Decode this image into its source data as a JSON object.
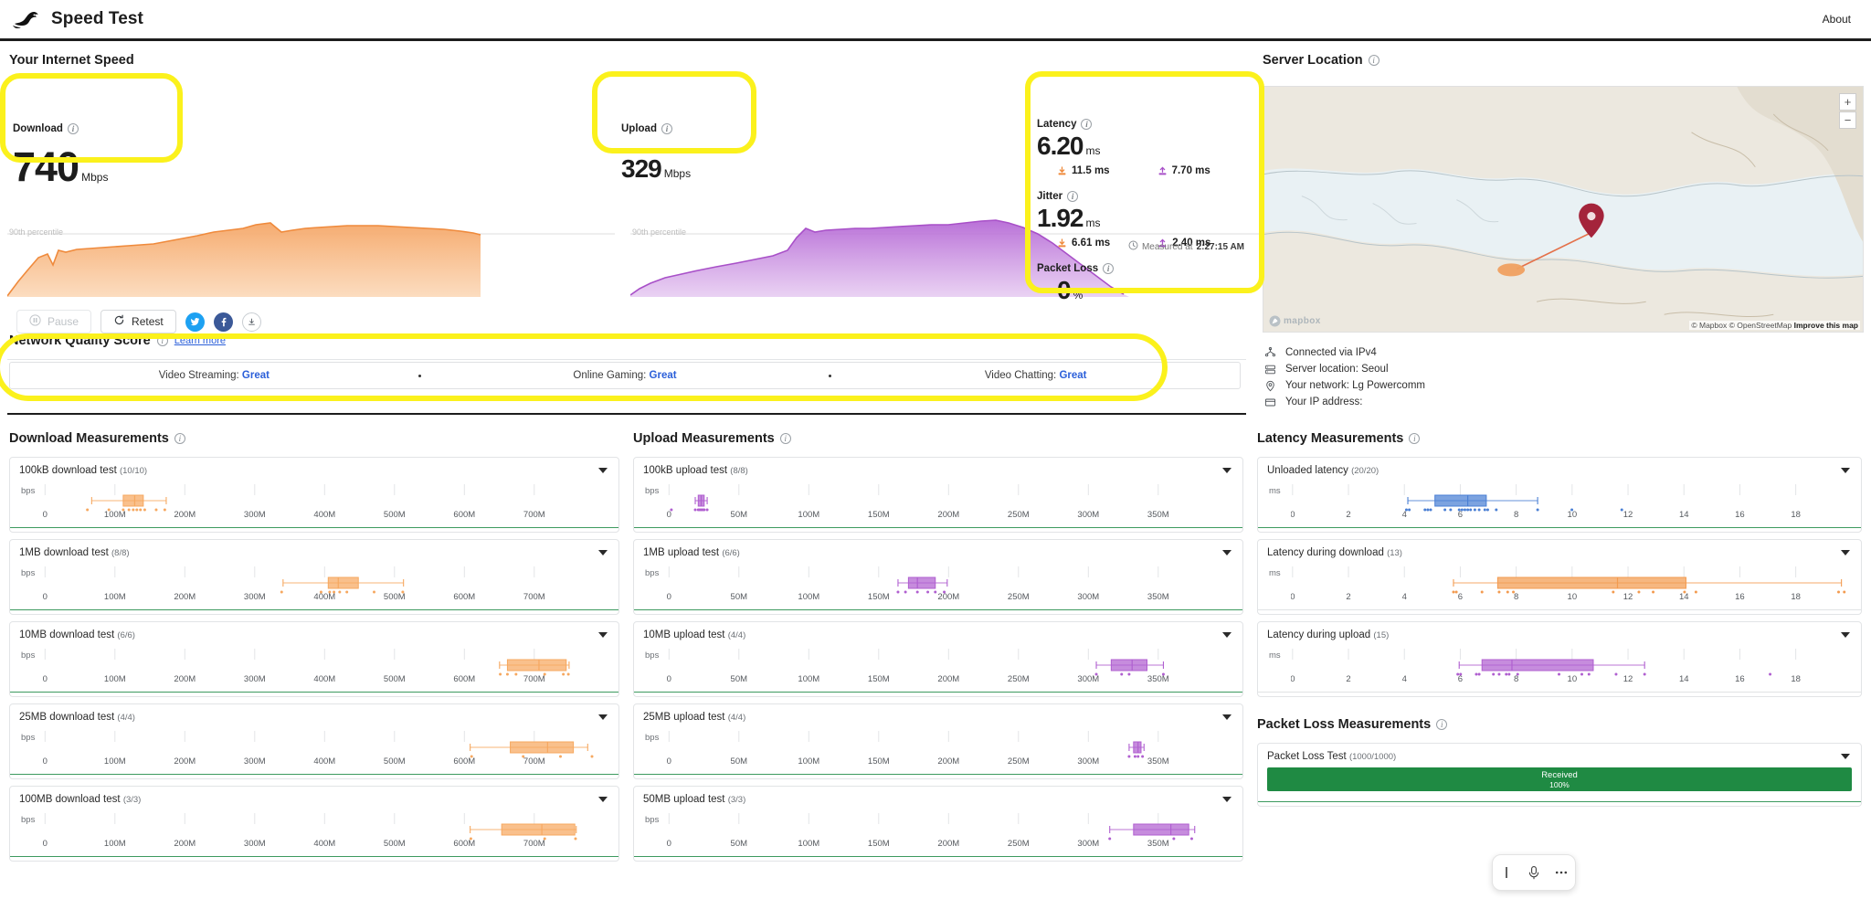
{
  "header": {
    "title": "Speed Test",
    "about_label": "About",
    "logo_icon": "rabbit-logo-icon"
  },
  "speed": {
    "section_title": "Your Internet Speed",
    "download": {
      "label": "Download",
      "value": "740",
      "unit": "Mbps",
      "percentile_label": "90th percentile"
    },
    "upload": {
      "label": "Upload",
      "value": "329",
      "unit": "Mbps",
      "percentile_label": "90th percentile"
    },
    "latency": {
      "label": "Latency",
      "value": "6.20",
      "unit": "ms",
      "download_sub": "11.5 ms",
      "upload_sub": "7.70 ms"
    },
    "jitter": {
      "label": "Jitter",
      "value": "1.92",
      "unit": "ms",
      "download_sub": "6.61 ms",
      "upload_sub": "2.40 ms"
    },
    "packet_loss": {
      "label": "Packet Loss",
      "value": "0",
      "unit": "%"
    },
    "measured_prefix": "Measured at",
    "measured_time": "2:27:15 AM"
  },
  "controls": {
    "pause_label": "Pause",
    "retest_label": "Retest",
    "twitter_icon": "twitter-icon",
    "facebook_icon": "facebook-icon",
    "download_icon": "download-icon"
  },
  "network_quality": {
    "title": "Network Quality Score",
    "learn_more": "Learn more",
    "items": [
      {
        "label": "Video Streaming:",
        "value": "Great"
      },
      {
        "label": "Online Gaming:",
        "value": "Great"
      },
      {
        "label": "Video Chatting:",
        "value": "Great"
      }
    ]
  },
  "server": {
    "title": "Server Location",
    "map_logo": "mapbox",
    "zoom_in": "+",
    "zoom_out": "−",
    "attribution": "© Mapbox © OpenStreetMap",
    "attribution_link": "Improve this map",
    "info": [
      {
        "icon": "network-icon",
        "text": "Connected via IPv4"
      },
      {
        "icon": "server-icon",
        "text": "Server location: Seoul"
      },
      {
        "icon": "location-icon",
        "text": "Your network: Lg Powercomm"
      },
      {
        "icon": "card-icon",
        "text": "Your IP address:"
      }
    ]
  },
  "measurements": {
    "download_title": "Download Measurements",
    "upload_title": "Upload Measurements",
    "latency_title": "Latency Measurements",
    "packet_loss_title": "Packet Loss Measurements",
    "download_tests": [
      {
        "name": "100kB download test",
        "count": "(10/10)"
      },
      {
        "name": "1MB download test",
        "count": "(8/8)"
      },
      {
        "name": "10MB download test",
        "count": "(6/6)"
      },
      {
        "name": "25MB download test",
        "count": "(4/4)"
      },
      {
        "name": "100MB download test",
        "count": "(3/3)"
      }
    ],
    "upload_tests": [
      {
        "name": "100kB upload test",
        "count": "(8/8)"
      },
      {
        "name": "1MB upload test",
        "count": "(6/6)"
      },
      {
        "name": "10MB upload test",
        "count": "(4/4)"
      },
      {
        "name": "25MB upload test",
        "count": "(4/4)"
      },
      {
        "name": "50MB upload test",
        "count": "(3/3)"
      }
    ],
    "latency_tests": [
      {
        "name": "Unloaded latency",
        "count": "(20/20)"
      },
      {
        "name": "Latency during download",
        "count": "(13)"
      },
      {
        "name": "Latency during upload",
        "count": "(15)"
      }
    ],
    "packet_loss_test": {
      "name": "Packet Loss Test",
      "count": "(1000/1000)",
      "bar_label": "Received",
      "bar_value": "100%"
    }
  },
  "chart_data": [
    {
      "type": "boxplot",
      "id": "dl-100kB",
      "unit": "bps",
      "xticks": [
        "0",
        "100M",
        "200M",
        "300M",
        "400M",
        "500M",
        "600M",
        "700M"
      ],
      "xlim": [
        0,
        780000000
      ],
      "color": "#f6a860",
      "box": {
        "min": 68000000,
        "q1": 112000000,
        "median": 128000000,
        "q3": 140000000,
        "max": 172000000
      },
      "points": [
        62000000,
        92000000,
        112000000,
        120000000,
        126000000,
        131000000,
        136000000,
        142000000,
        158000000,
        170000000
      ]
    },
    {
      "type": "boxplot",
      "id": "dl-1MB",
      "unit": "bps",
      "xticks": [
        "0",
        "100M",
        "200M",
        "300M",
        "400M",
        "500M",
        "600M",
        "700M"
      ],
      "xlim": [
        0,
        780000000
      ],
      "color": "#f6a860",
      "box": {
        "min": 335000000,
        "q1": 398000000,
        "median": 412000000,
        "q3": 440000000,
        "max": 503000000
      },
      "points": [
        333000000,
        388000000,
        400000000,
        406000000,
        414000000,
        424000000,
        462000000,
        502000000
      ]
    },
    {
      "type": "boxplot",
      "id": "dl-10MB",
      "unit": "bps",
      "xticks": [
        "0",
        "100M",
        "200M",
        "300M",
        "400M",
        "500M",
        "600M",
        "700M"
      ],
      "xlim": [
        0,
        780000000
      ],
      "color": "#f6a860",
      "box": {
        "min": 637000000,
        "q1": 648000000,
        "median": 692000000,
        "q3": 730000000,
        "max": 734000000
      },
      "points": [
        638000000,
        648000000,
        660000000,
        700000000,
        726000000,
        733000000
      ]
    },
    {
      "type": "boxplot",
      "id": "dl-25MB",
      "unit": "bps",
      "xticks": [
        "0",
        "100M",
        "200M",
        "300M",
        "400M",
        "500M",
        "600M",
        "700M"
      ],
      "xlim": [
        0,
        780000000
      ],
      "color": "#f6a860",
      "box": {
        "min": 596000000,
        "q1": 652000000,
        "median": 704000000,
        "q3": 740000000,
        "max": 760000000
      },
      "points": [
        598000000,
        670000000,
        722000000,
        766000000
      ]
    },
    {
      "type": "boxplot",
      "id": "dl-100MB",
      "unit": "bps",
      "xticks": [
        "0",
        "100M",
        "200M",
        "300M",
        "400M",
        "500M",
        "600M",
        "700M"
      ],
      "xlim": [
        0,
        780000000
      ],
      "color": "#f6a860",
      "box": {
        "min": 596000000,
        "q1": 640000000,
        "median": 696000000,
        "q3": 742000000,
        "max": 744000000
      },
      "points": [
        597000000,
        700000000,
        743000000
      ]
    },
    {
      "type": "boxplot",
      "id": "ul-100kB",
      "unit": "bps",
      "xticks": [
        "0",
        "50M",
        "100M",
        "150M",
        "200M",
        "250M",
        "300M",
        "350M"
      ],
      "xlim": [
        0,
        375000000
      ],
      "color": "#b05fd0",
      "box": {
        "min": 19000000,
        "q1": 21000000,
        "median": 23000000,
        "q3": 25000000,
        "max": 27000000
      },
      "points": [
        3000000,
        19000000,
        21000000,
        22000000,
        23000000,
        24000000,
        25000000,
        27000000
      ]
    },
    {
      "type": "boxplot",
      "id": "ul-1MB",
      "unit": "bps",
      "xticks": [
        "0",
        "50M",
        "100M",
        "150M",
        "200M",
        "250M",
        "300M",
        "350M"
      ],
      "xlim": [
        0,
        375000000
      ],
      "color": "#b05fd0",
      "box": {
        "min": 155000000,
        "q1": 162000000,
        "median": 168000000,
        "q3": 180000000,
        "max": 188000000
      },
      "points": [
        155000000,
        160000000,
        168000000,
        175000000,
        180000000,
        186000000
      ]
    },
    {
      "type": "boxplot",
      "id": "ul-10MB",
      "unit": "bps",
      "xticks": [
        "0",
        "50M",
        "100M",
        "150M",
        "200M",
        "250M",
        "300M",
        "350M"
      ],
      "xlim": [
        0,
        375000000
      ],
      "color": "#b05fd0",
      "box": {
        "min": 288000000,
        "q1": 298000000,
        "median": 312000000,
        "q3": 322000000,
        "max": 333000000
      },
      "points": [
        288000000,
        305000000,
        310000000,
        333000000
      ]
    },
    {
      "type": "boxplot",
      "id": "ul-25MB",
      "unit": "bps",
      "xticks": [
        "0",
        "50M",
        "100M",
        "150M",
        "200M",
        "250M",
        "300M",
        "350M"
      ],
      "xlim": [
        0,
        375000000
      ],
      "color": "#b05fd0",
      "box": {
        "min": 310000000,
        "q1": 313000000,
        "median": 316000000,
        "q3": 318000000,
        "max": 320000000
      },
      "points": [
        310000000,
        314000000,
        316000000,
        319000000
      ]
    },
    {
      "type": "boxplot",
      "id": "ul-50MB",
      "unit": "bps",
      "xticks": [
        "0",
        "50M",
        "100M",
        "150M",
        "200M",
        "250M",
        "300M",
        "350M"
      ],
      "xlim": [
        0,
        375000000
      ],
      "color": "#b05fd0",
      "box": {
        "min": 297000000,
        "q1": 313000000,
        "median": 338000000,
        "q3": 350000000,
        "max": 354000000
      },
      "points": [
        297000000,
        340000000,
        352000000
      ]
    },
    {
      "type": "boxplot",
      "id": "lat-unloaded",
      "unit": "ms",
      "xticks": [
        "0",
        "2",
        "4",
        "6",
        "8",
        "10",
        "12",
        "14",
        "16",
        "18"
      ],
      "xlim": [
        0,
        19.6
      ],
      "color": "#4a7fd4",
      "box": {
        "min": 4.1,
        "q1": 5.05,
        "median": 6.2,
        "q3": 6.85,
        "max": 8.65
      },
      "points": [
        4.05,
        4.15,
        4.7,
        4.8,
        4.9,
        5.4,
        5.6,
        5.9,
        6.0,
        6.1,
        6.2,
        6.3,
        6.6,
        6.8,
        6.9,
        7.2,
        8.65,
        9.85,
        11.6,
        6.45
      ]
    },
    {
      "type": "boxplot",
      "id": "lat-download",
      "unit": "ms",
      "xticks": [
        "0",
        "2",
        "4",
        "6",
        "8",
        "10",
        "12",
        "14",
        "16",
        "18"
      ],
      "xlim": [
        0,
        19.6
      ],
      "color": "#f39b50",
      "box": {
        "min": 5.7,
        "q1": 7.25,
        "median": 11.45,
        "q3": 13.85,
        "max": 19.3
      },
      "points": [
        5.7,
        5.8,
        6.7,
        7.3,
        7.6,
        7.8,
        11.3,
        12.2,
        12.7,
        13.8,
        14.2,
        19.2,
        19.4
      ]
    },
    {
      "type": "boxplot",
      "id": "lat-upload",
      "unit": "ms",
      "xticks": [
        "0",
        "2",
        "4",
        "6",
        "8",
        "10",
        "12",
        "14",
        "16",
        "18"
      ],
      "xlim": [
        0,
        19.6
      ],
      "color": "#b05fd0",
      "box": {
        "min": 5.9,
        "q1": 6.7,
        "median": 7.75,
        "q3": 10.6,
        "max": 12.4
      },
      "points": [
        5.85,
        5.95,
        6.5,
        6.6,
        7.1,
        7.3,
        7.55,
        7.65,
        7.95,
        9.4,
        10.2,
        10.45,
        11.4,
        12.4,
        16.8
      ]
    },
    {
      "type": "timeseries",
      "id": "download-wave",
      "ylabel": "Mbps",
      "color": "#f08a3c",
      "percentile_label": "90th percentile",
      "values": [
        2,
        18,
        52,
        118,
        170,
        210,
        188,
        196,
        232,
        238,
        240,
        244,
        246,
        248,
        250,
        252,
        254,
        256,
        258,
        262,
        268,
        274,
        282,
        290,
        300,
        308,
        300,
        296,
        318,
        312,
        316,
        318,
        320,
        322,
        324,
        326,
        328,
        330,
        332,
        334,
        334,
        336,
        336,
        336,
        334,
        330,
        326,
        322,
        318,
        314,
        310,
        306,
        300,
        296,
        292,
        288
      ]
    },
    {
      "type": "timeseries",
      "id": "upload-wave",
      "ylabel": "Mbps",
      "color": "#b05fd0",
      "percentile_label": "90th percentile",
      "values": [
        2,
        4,
        8,
        14,
        22,
        30,
        40,
        52,
        64,
        78,
        92,
        108,
        126,
        148,
        170,
        196,
        226,
        240,
        248,
        252,
        258,
        262,
        266,
        270,
        274,
        278,
        282,
        286,
        290,
        294,
        298,
        302,
        308,
        314,
        320,
        328,
        336,
        344,
        352,
        360,
        366,
        372,
        376,
        380,
        382,
        384,
        384,
        382,
        378,
        372,
        366,
        358,
        350,
        340,
        330,
        320
      ]
    }
  ]
}
